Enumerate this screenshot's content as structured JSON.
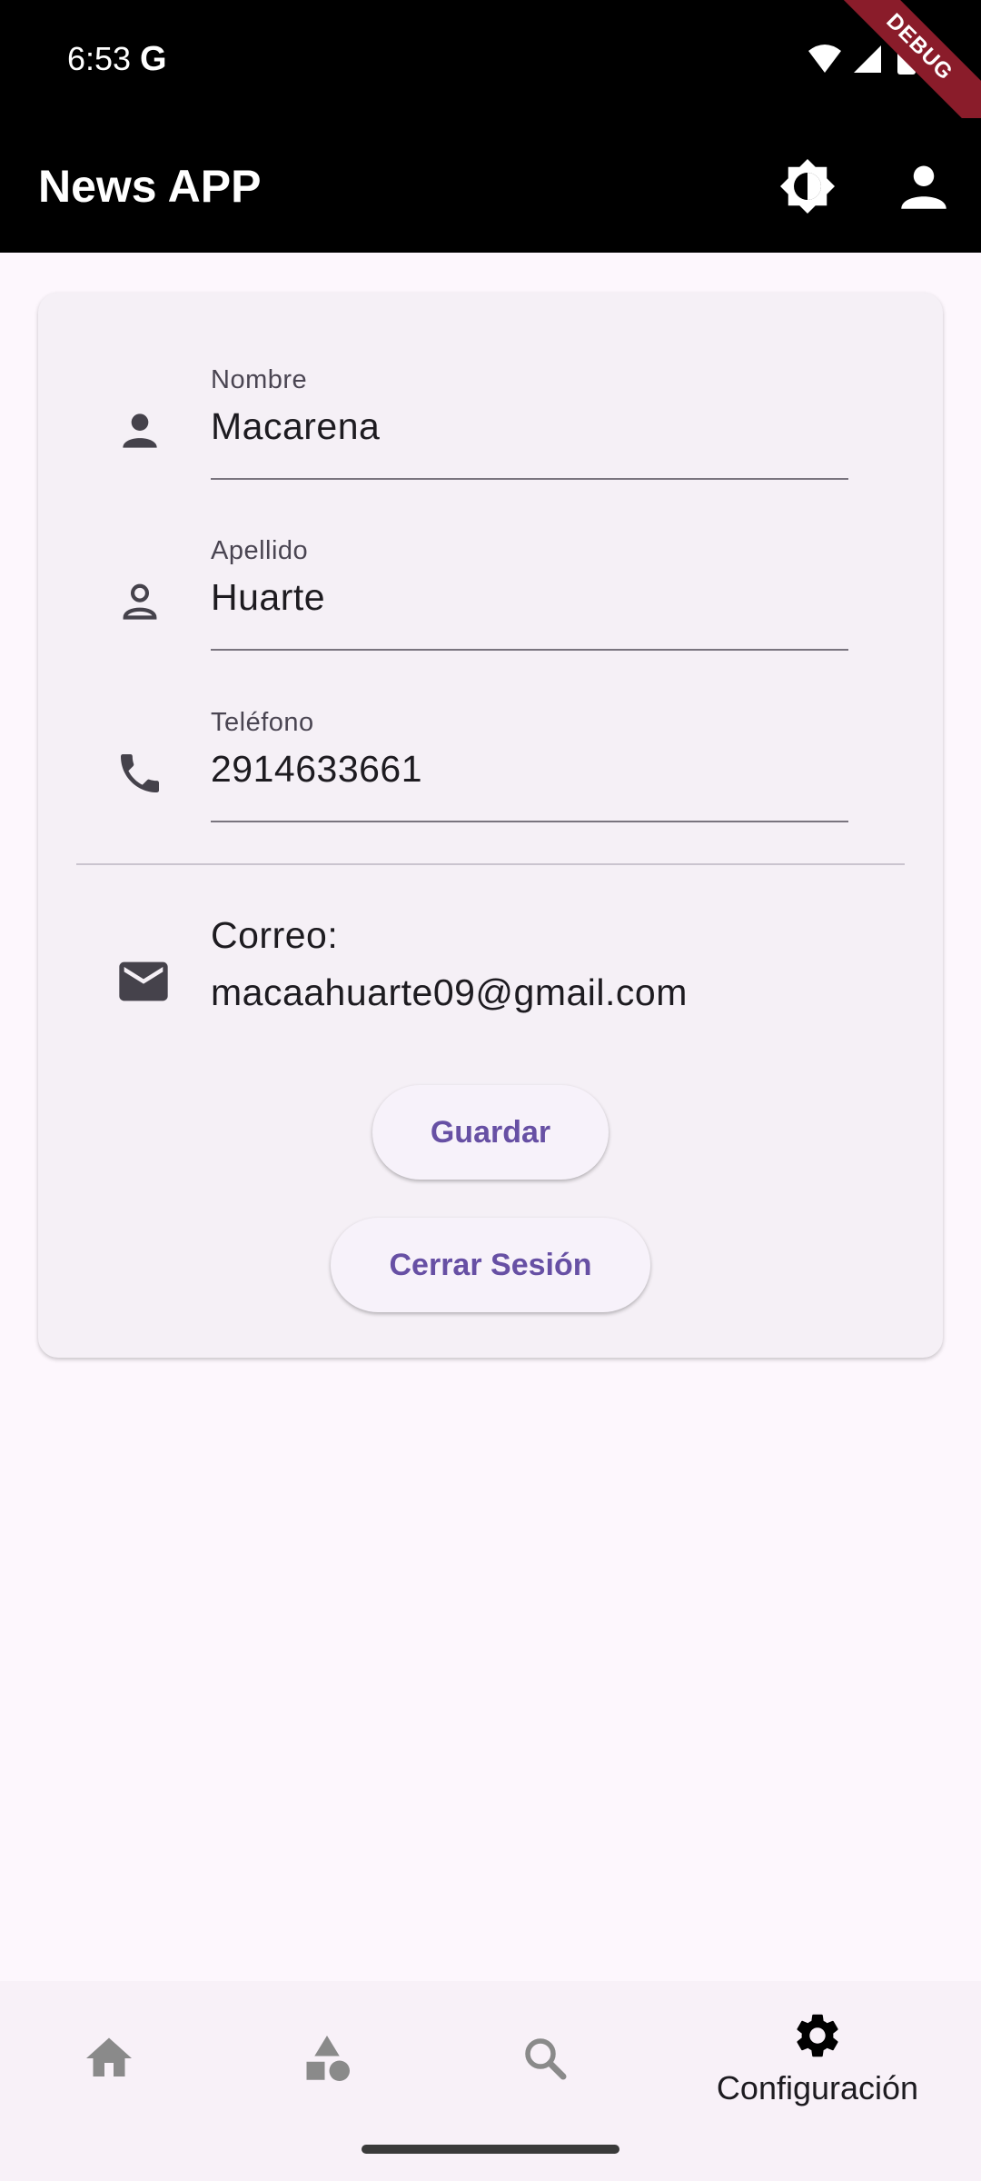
{
  "status_bar": {
    "time": "6:53",
    "g_glyph": "G",
    "debug_label": "DEBUG"
  },
  "app_bar": {
    "title": "News APP",
    "icons": [
      "brightness-icon",
      "profile-icon"
    ]
  },
  "form": {
    "nombre": {
      "label": "Nombre",
      "value": "Macarena",
      "icon": "person-icon"
    },
    "apellido": {
      "label": "Apellido",
      "value": "Huarte",
      "icon": "person-outline-icon"
    },
    "telefono": {
      "label": "Teléfono",
      "value": "2914633661",
      "icon": "phone-icon"
    },
    "correo": {
      "label": "Correo:",
      "value": "macaahuarte09@gmail.com",
      "icon": "mail-icon"
    },
    "save_label": "Guardar",
    "logout_label": "Cerrar Sesión"
  },
  "bottom_nav": {
    "items": [
      {
        "icon": "home-icon",
        "selected": false
      },
      {
        "icon": "categories-icon",
        "selected": false
      },
      {
        "icon": "search-icon",
        "selected": false
      },
      {
        "icon": "settings-icon",
        "label": "Configuración",
        "selected": true
      }
    ]
  },
  "colors": {
    "bar_bg": "#000000",
    "page_bg": "#fdf7fd",
    "card_bg": "#f5f0f6",
    "accent": "#6750a4",
    "icon_dark": "#45424b",
    "nav_inactive": "#8a8a8a",
    "debug_ribbon": "#8a1c2a"
  }
}
